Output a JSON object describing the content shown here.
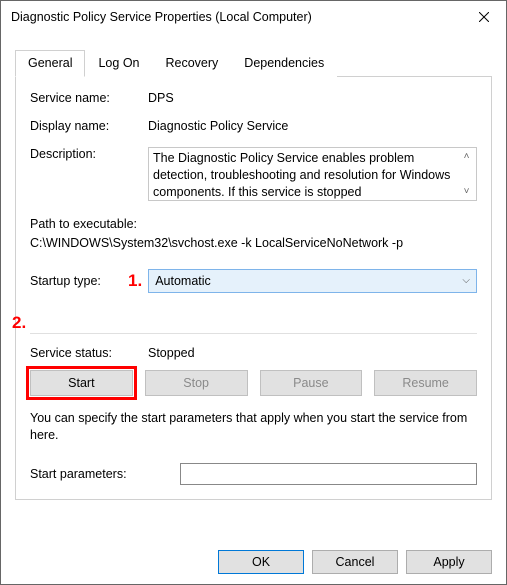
{
  "window": {
    "title": "Diagnostic Policy Service Properties (Local Computer)"
  },
  "tabs": {
    "general": "General",
    "logon": "Log On",
    "recovery": "Recovery",
    "dependencies": "Dependencies"
  },
  "fields": {
    "service_name_label": "Service name:",
    "service_name": "DPS",
    "display_name_label": "Display name:",
    "display_name": "Diagnostic Policy Service",
    "description_label": "Description:",
    "description": "The Diagnostic Policy Service enables problem detection, troubleshooting and resolution for Windows components.  If this service is stopped",
    "path_label": "Path to executable:",
    "path": "C:\\WINDOWS\\System32\\svchost.exe -k LocalServiceNoNetwork -p",
    "startup_label": "Startup type:",
    "startup_value": "Automatic",
    "status_label": "Service status:",
    "status_value": "Stopped",
    "hint": "You can specify the start parameters that apply when you start the service from here.",
    "start_params_label": "Start parameters:",
    "start_params_value": ""
  },
  "buttons": {
    "start": "Start",
    "stop": "Stop",
    "pause": "Pause",
    "resume": "Resume",
    "ok": "OK",
    "cancel": "Cancel",
    "apply": "Apply"
  },
  "annotations": {
    "one": "1.",
    "two": "2."
  }
}
